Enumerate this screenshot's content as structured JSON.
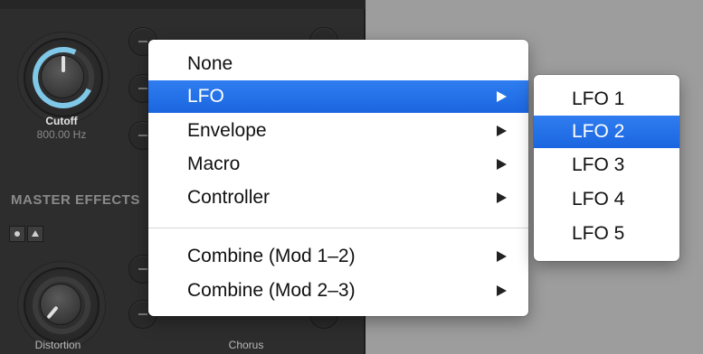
{
  "synth": {
    "filter_knob": {
      "label": "Cutoff",
      "value": "800.00 Hz"
    },
    "section_title": "MASTER EFFECTS",
    "effects": [
      {
        "label": "Distortion"
      },
      {
        "label": "Chorus"
      }
    ]
  },
  "menu": {
    "items": [
      {
        "label": "None",
        "has_submenu": false,
        "selected": false
      },
      {
        "label": "LFO",
        "has_submenu": true,
        "selected": true
      },
      {
        "label": "Envelope",
        "has_submenu": true,
        "selected": false
      },
      {
        "label": "Macro",
        "has_submenu": true,
        "selected": false
      },
      {
        "label": "Controller",
        "has_submenu": true,
        "selected": false
      },
      {
        "label": "Combine (Mod 1–2)",
        "has_submenu": true,
        "selected": false
      },
      {
        "label": "Combine (Mod 2–3)",
        "has_submenu": true,
        "selected": false
      }
    ]
  },
  "submenu": {
    "items": [
      {
        "label": "LFO 1",
        "selected": false
      },
      {
        "label": "LFO 2",
        "selected": true
      },
      {
        "label": "LFO 3",
        "selected": false
      },
      {
        "label": "LFO 4",
        "selected": false
      },
      {
        "label": "LFO 5",
        "selected": false
      }
    ]
  },
  "colors": {
    "selection": "#1f6fe5",
    "knob_accent": "#7fc8e8",
    "panel_bg": "#2d2d2d",
    "desktop_bg": "#9d9d9d"
  }
}
